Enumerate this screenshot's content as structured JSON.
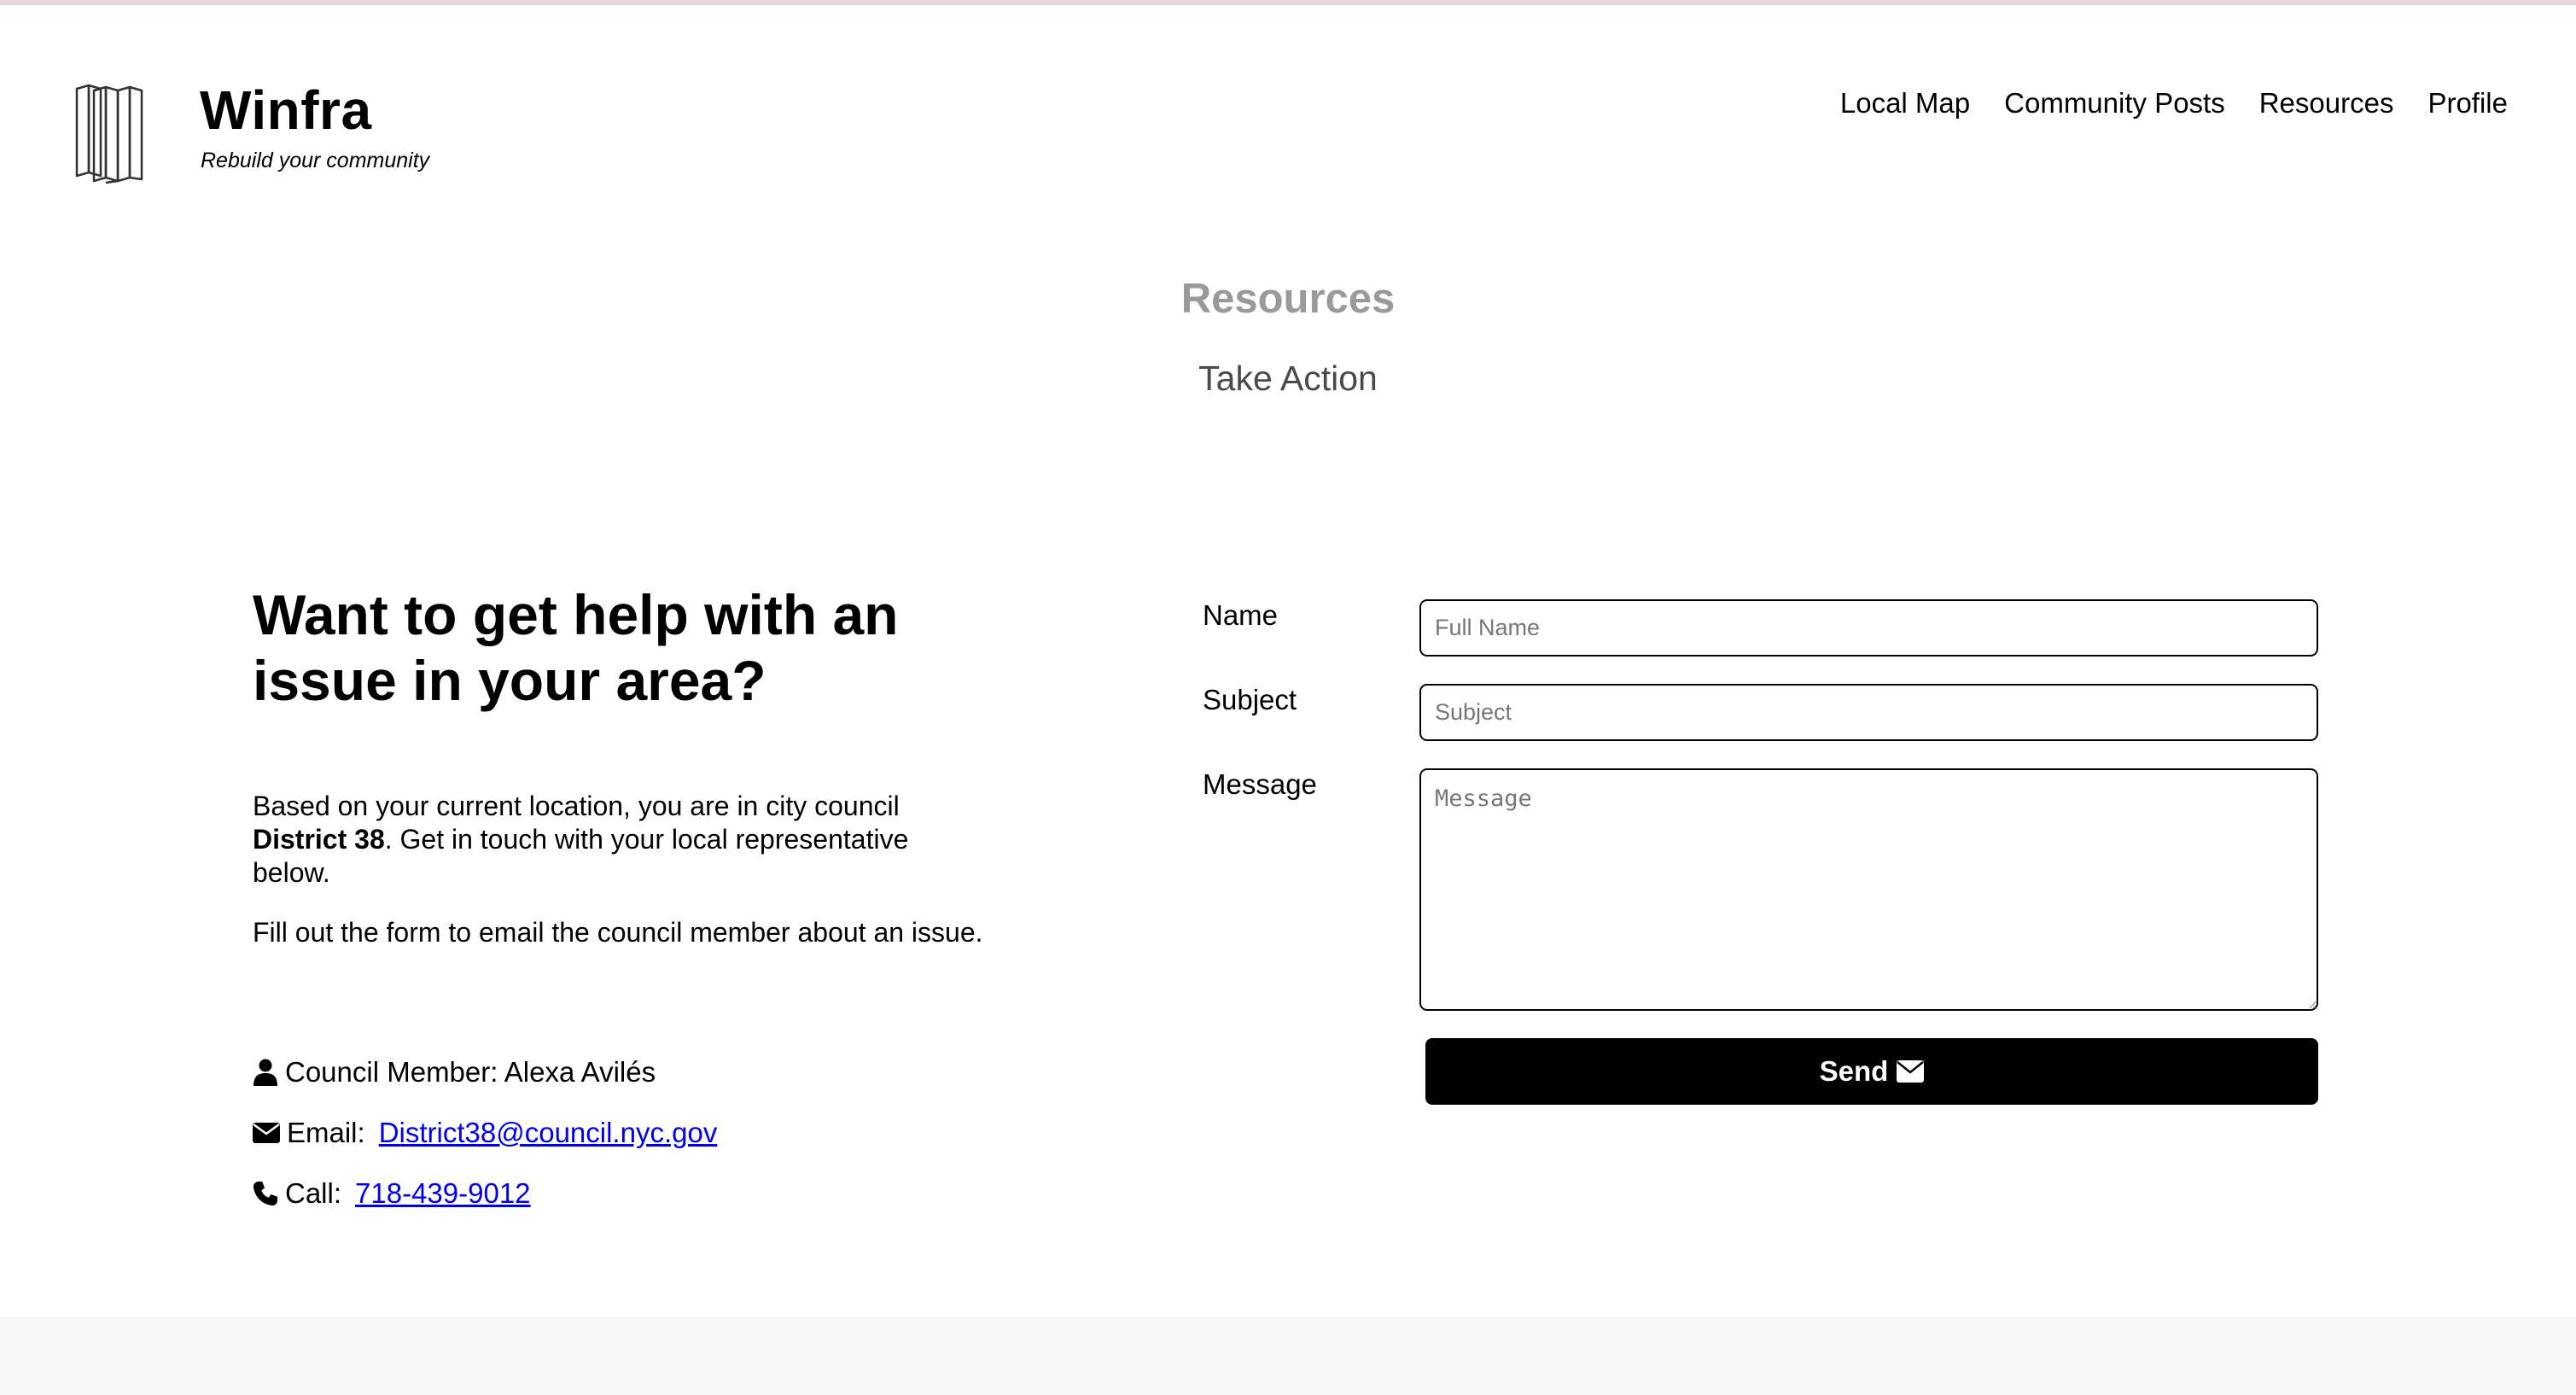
{
  "brand": {
    "name": "Winfra",
    "tagline": "Rebuild your community",
    "logo_icon": "building-columns-icon"
  },
  "nav": {
    "items": [
      {
        "label": "Local Map"
      },
      {
        "label": "Community Posts"
      },
      {
        "label": "Resources"
      },
      {
        "label": "Profile"
      }
    ]
  },
  "section": {
    "title": "Resources",
    "subtitle": "Take Action"
  },
  "help": {
    "heading": "Want to get help with an issue in your area?",
    "para1_before": "Based on your current location, you are in city council ",
    "district": "District 38",
    "para1_after": ". Get in touch with your local representative below.",
    "para2": "Fill out the form to email the council member about an issue."
  },
  "contact": {
    "member_text": "Council Member: Alexa Avilés",
    "email_label": "Email:",
    "email_value": "District38@council.nyc.gov",
    "call_label": "Call:",
    "call_value": "718-439-9012"
  },
  "form": {
    "name_label": "Name",
    "name_placeholder": "Full Name",
    "subject_label": "Subject",
    "subject_placeholder": "Subject",
    "message_label": "Message",
    "message_placeholder": "Message",
    "send_label": "Send"
  },
  "colors": {
    "accent": "#000000",
    "link": "#0000ee",
    "muted_title": "#9a9a9a",
    "footer_bg": "#f7f7f7"
  }
}
